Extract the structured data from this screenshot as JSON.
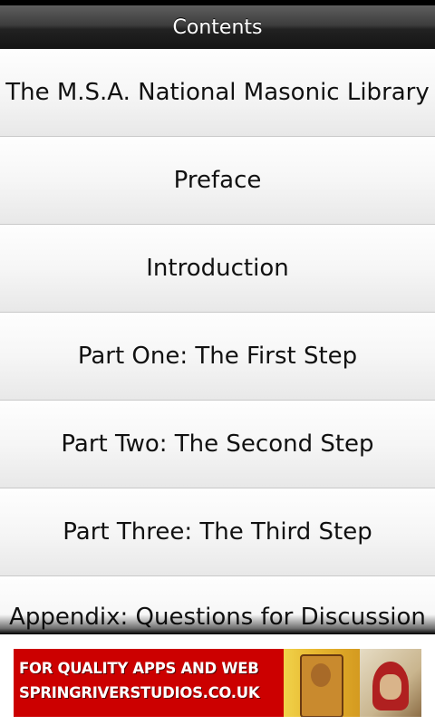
{
  "header": {
    "title": "Contents"
  },
  "contents": {
    "items": [
      {
        "label": "The M.S.A. National Masonic Library"
      },
      {
        "label": "Preface"
      },
      {
        "label": "Introduction"
      },
      {
        "label": "Part One: The First Step"
      },
      {
        "label": "Part Two: The Second Step"
      },
      {
        "label": "Part Three: The Third Step"
      },
      {
        "label": "Appendix: Questions for Discussion"
      }
    ]
  },
  "ad": {
    "line1": "FOR QUALITY APPS AND WEB",
    "line2": "SPRINGRIVERSTUDIOS.CO.UK",
    "background_color": "#cc0000"
  }
}
